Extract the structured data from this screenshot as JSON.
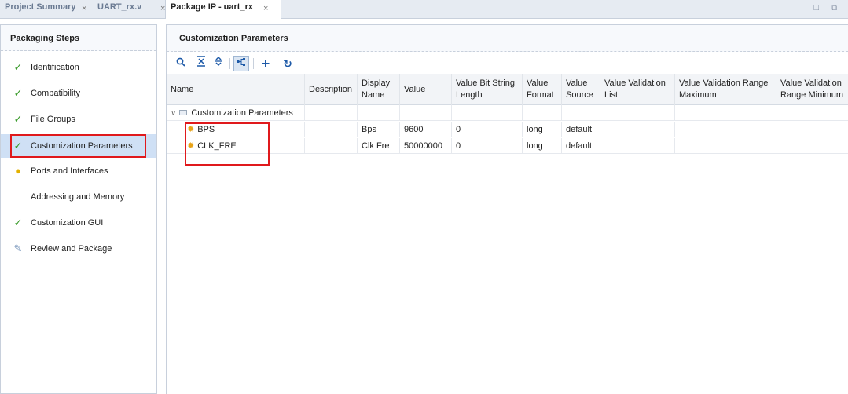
{
  "tabs": [
    {
      "label": "Project Summary",
      "active": false
    },
    {
      "label": "UART_rx.v",
      "active": false
    },
    {
      "label": "Package IP - uart_rx",
      "active": true
    }
  ],
  "tab_close_glyph": "×",
  "window_buttons": "□ ⧉",
  "left_panel": {
    "title": "Packaging Steps",
    "steps": [
      {
        "label": "Identification",
        "status": "done"
      },
      {
        "label": "Compatibility",
        "status": "done"
      },
      {
        "label": "File Groups",
        "status": "done"
      },
      {
        "label": "Customization Parameters",
        "status": "done",
        "selected": true
      },
      {
        "label": "Ports and Interfaces",
        "status": "warning"
      },
      {
        "label": "Addressing and Memory",
        "status": "none"
      },
      {
        "label": "Customization GUI",
        "status": "done"
      },
      {
        "label": "Review and Package",
        "status": "review"
      }
    ]
  },
  "right_panel": {
    "title": "Customization Parameters",
    "toolbar": [
      "search-icon",
      "collapse-all-icon",
      "expand-all-icon",
      "hierarchy-icon",
      "add-icon",
      "refresh-icon"
    ],
    "columns": [
      "Name",
      "Description",
      "Display Name",
      "Value",
      "Value Bit String Length",
      "Value Format",
      "Value Source",
      "Value Validation List",
      "Value Validation Range Maximum",
      "Value Validation Range Minimum"
    ],
    "group": {
      "label": "Customization Parameters"
    },
    "rows": [
      {
        "name": "BPS",
        "description": "",
        "display_name": "Bps",
        "value": "9600",
        "bit_length": "0",
        "format": "long",
        "source": "default",
        "validation_list": "",
        "range_max": "",
        "range_min": ""
      },
      {
        "name": "CLK_FRE",
        "description": "",
        "display_name": "Clk Fre",
        "value": "50000000",
        "bit_length": "0",
        "format": "long",
        "source": "default",
        "validation_list": "",
        "range_max": "",
        "range_min": ""
      }
    ]
  },
  "colors": {
    "highlight": "#e0191c",
    "selected": "#cfe0f5",
    "check": "#3a9b2a",
    "warning": "#e3b100"
  }
}
